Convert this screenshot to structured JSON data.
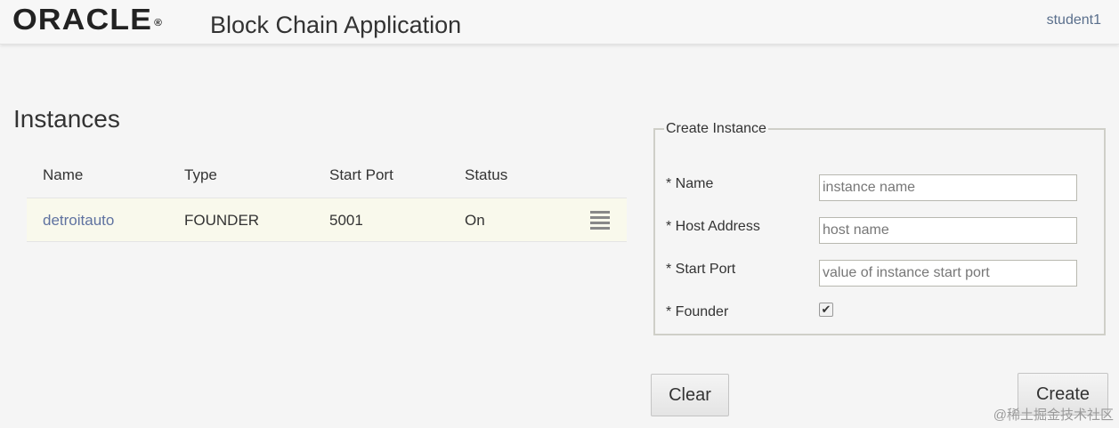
{
  "header": {
    "logo_text": "ORACLE",
    "logo_mark": "®",
    "app_title": "Block Chain Application",
    "user": "student1"
  },
  "instances": {
    "title": "Instances",
    "columns": [
      "Name",
      "Type",
      "Start Port",
      "Status"
    ],
    "rows": [
      {
        "name": "detroitauto",
        "type": "FOUNDER",
        "start_port": "5001",
        "status": "On",
        "menu_icon": "hamburger-menu-icon"
      }
    ]
  },
  "create_instance": {
    "legend": "Create Instance",
    "fields": {
      "name": {
        "label": "* Name",
        "placeholder": "instance name",
        "value": ""
      },
      "host": {
        "label": "* Host Address",
        "placeholder": "host name",
        "value": ""
      },
      "port": {
        "label": "* Start Port",
        "placeholder": "value of instance start port",
        "value": ""
      },
      "founder": {
        "label": "* Founder",
        "checked": true,
        "check_glyph": "✔"
      }
    },
    "clear_label": "Clear",
    "create_label": "Create"
  },
  "watermark": "@稀土掘金技术社区"
}
